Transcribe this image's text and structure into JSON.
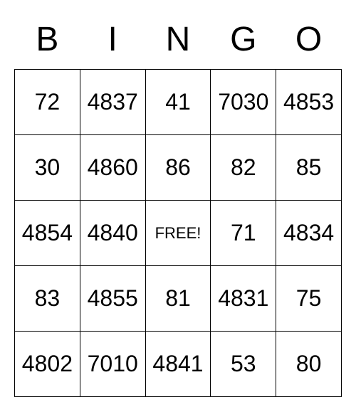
{
  "headers": [
    "B",
    "I",
    "N",
    "G",
    "O"
  ],
  "grid": [
    [
      "72",
      "4837",
      "41",
      "7030",
      "4853"
    ],
    [
      "30",
      "4860",
      "86",
      "82",
      "85"
    ],
    [
      "4854",
      "4840",
      "FREE!",
      "71",
      "4834"
    ],
    [
      "83",
      "4855",
      "81",
      "4831",
      "75"
    ],
    [
      "4802",
      "7010",
      "4841",
      "53",
      "80"
    ]
  ],
  "free_cell_value": "FREE!"
}
